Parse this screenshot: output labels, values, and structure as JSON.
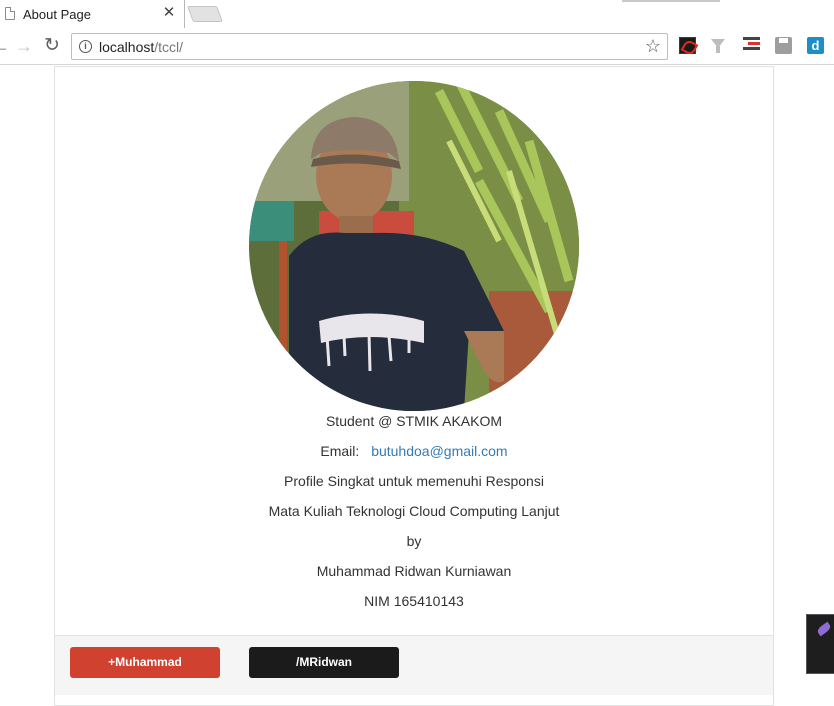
{
  "browser": {
    "tab_title": "About Page",
    "tab_close": "✕",
    "url_host": "localhost",
    "url_path": "/tccl/"
  },
  "profile": {
    "tagline": "Student @ STMIK AKAKOM",
    "email_label": "Email:",
    "email": "butuhdoa@gmail.com",
    "line1": "Profile Singkat untuk memenuhi Responsi",
    "line2": "Mata Kuliah Teknologi Cloud Computing Lanjut",
    "line3": "by",
    "name": "Muhammad Ridwan Kurniawan",
    "nim": "NIM 165410143"
  },
  "footer": {
    "gplus_label": "+Muhammad",
    "github_label": "/MRidwan"
  },
  "colors": {
    "gplus": "#d14130",
    "github": "#1b1b1b",
    "link": "#337ab7"
  }
}
